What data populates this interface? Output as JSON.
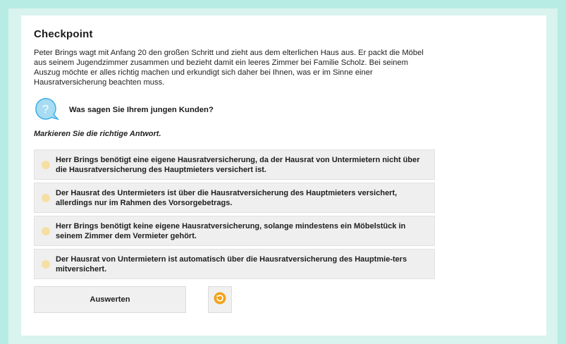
{
  "checkpoint": {
    "title": "Checkpoint",
    "intro": "Peter Brings wagt mit Anfang 20 den großen Schritt und zieht aus dem elterlichen Haus aus. Er packt die Möbel aus seinem Jugendzimmer zusammen und bezieht damit ein leeres Zimmer bei Familie Scholz. Bei seinem Auszug möchte er alles richtig machen und erkundigt sich daher bei Ihnen, was er im Sinne einer Hausratversicherung beachten muss.",
    "question_icon": "question-bubble-icon",
    "question": "Was sagen Sie Ihrem jungen Kunden?",
    "instruction": "Markieren Sie die richtige Antwort.",
    "answers": [
      {
        "label": "Herr Brings benötigt eine eigene Hausratversicherung, da der Hausrat von Untermietern nicht über die Hausratversicherung des Hauptmieters versichert ist."
      },
      {
        "label": "Der Hausrat des Untermieters ist über die Hausratversicherung des Hauptmieters versichert, allerdings nur im Rahmen des Vorsorgebetrags."
      },
      {
        "label": "Herr Brings benötigt keine eigene Hausratversicherung, solange mindestens ein Möbelstück in seinem Zimmer dem Vermieter gehört."
      },
      {
        "label": "Der Hausrat von Untermietern ist automatisch über die Hausratversicherung des Hauptmie-ters mitversichert."
      }
    ],
    "evaluate_label": "Auswerten",
    "reset_icon": "reset-icon"
  },
  "colors": {
    "background": "#b7ece4",
    "accent_blue": "#3aaee8",
    "radio": "#f6dfa3",
    "reset_orange": "#f2a31b"
  }
}
